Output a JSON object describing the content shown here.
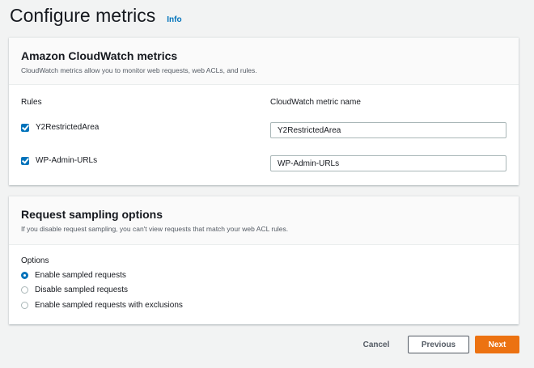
{
  "header": {
    "title": "Configure metrics",
    "info_link": "Info"
  },
  "metrics_panel": {
    "title": "Amazon CloudWatch metrics",
    "description": "CloudWatch metrics allow you to monitor web requests, web ACLs, and rules.",
    "rules_header": "Rules",
    "metric_name_header": "CloudWatch metric name",
    "rules": [
      {
        "label": "Y2RestrictedArea",
        "checked": true,
        "metric_name": "Y2RestrictedArea"
      },
      {
        "label": "WP-Admin-URLs",
        "checked": true,
        "metric_name": "WP-Admin-URLs"
      }
    ]
  },
  "sampling_panel": {
    "title": "Request sampling options",
    "description": "If you disable request sampling, you can't view requests that match your web ACL rules.",
    "options_label": "Options",
    "options": [
      {
        "label": "Enable sampled requests",
        "selected": true
      },
      {
        "label": "Disable sampled requests",
        "selected": false
      },
      {
        "label": "Enable sampled requests with exclusions",
        "selected": false
      }
    ]
  },
  "footer": {
    "cancel_label": "Cancel",
    "previous_label": "Previous",
    "next_label": "Next"
  },
  "colors": {
    "accent": "#0073bb",
    "primary_button": "#ec7211",
    "background": "#f2f3f3"
  }
}
